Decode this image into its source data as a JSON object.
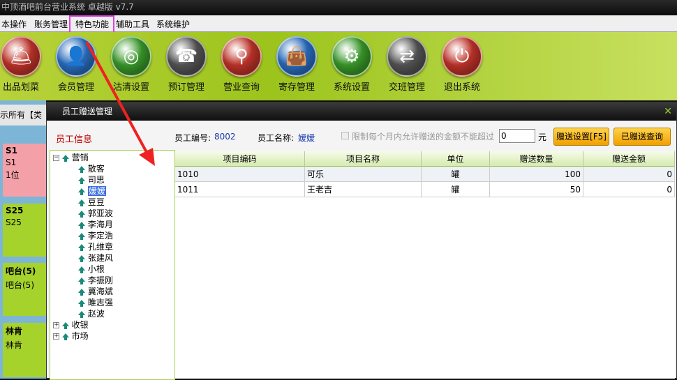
{
  "window": {
    "title": "中顶酒吧前台营业系统 卓越版 v7.7"
  },
  "menu": [
    "本操作",
    "账务管理",
    "特色功能",
    "辅助工具",
    "系统维护"
  ],
  "toolbar": [
    {
      "label": "出品划菜",
      "icon": "cloche-icon",
      "color": "#c0342a"
    },
    {
      "label": "会员管理",
      "icon": "member-icon",
      "color": "#2a6ec0"
    },
    {
      "label": "沽清设置",
      "icon": "plate-icon",
      "color": "#3a9a2a"
    },
    {
      "label": "预订管理",
      "icon": "phone-icon",
      "color": "#555555"
    },
    {
      "label": "营业查询",
      "icon": "magnifier-icon",
      "color": "#c0342a"
    },
    {
      "label": "寄存管理",
      "icon": "bag-icon",
      "color": "#2a6ec0"
    },
    {
      "label": "系统设置",
      "icon": "gear-icon",
      "color": "#3a9a2a"
    },
    {
      "label": "交班管理",
      "icon": "handover-icon",
      "color": "#555555"
    },
    {
      "label": "退出系统",
      "icon": "power-icon",
      "color": "#c0342a"
    }
  ],
  "filter_text": "示所有【类",
  "rooms": [
    {
      "title": "S1",
      "sub": "S1",
      "extra": "1位",
      "color": "#f4a0a8"
    },
    {
      "title": "S25",
      "sub": "S25",
      "extra": "",
      "color": "#a6d22c"
    },
    {
      "title": "吧台(5)",
      "sub": "吧台(5)",
      "extra": "",
      "color": "#a6d22c"
    },
    {
      "title": "林肯",
      "sub": "林肯",
      "extra": "",
      "color": "#a6d22c"
    }
  ],
  "dialog": {
    "title": "员工赠送管理",
    "section_label": "员工信息",
    "staff_no_label": "员工编号:",
    "staff_no": "8002",
    "staff_name_label": "员工名称:",
    "staff_name": "嫒嫒",
    "limit_label": "限制每个月内允许赠送的金额不能超过",
    "limit_value": "0",
    "limit_unit": "元",
    "btn_gift_settings": "赠送设置[F5]",
    "btn_gift_query": "已赠送查询"
  },
  "tree": {
    "groups": [
      {
        "name": "营销",
        "expanded": true,
        "children": [
          "散客",
          "司思",
          "嫒嫒",
          "豆豆",
          "郭亚波",
          "李海月",
          "李定浩",
          "孔维章",
          "张建风",
          "小根",
          "李振刚",
          "冀海斌",
          "睢志强",
          "赵波"
        ]
      },
      {
        "name": "收银",
        "expanded": false,
        "children": []
      },
      {
        "name": "市场",
        "expanded": false,
        "children": []
      }
    ],
    "selected": "嫒嫒"
  },
  "grid": {
    "columns": [
      "项目编码",
      "项目名称",
      "单位",
      "赠送数量",
      "赠送金额"
    ],
    "rows": [
      [
        "1010",
        "可乐",
        "罐",
        "100",
        "0"
      ],
      [
        "1011",
        "王老吉",
        "罐",
        "50",
        "0"
      ]
    ]
  }
}
